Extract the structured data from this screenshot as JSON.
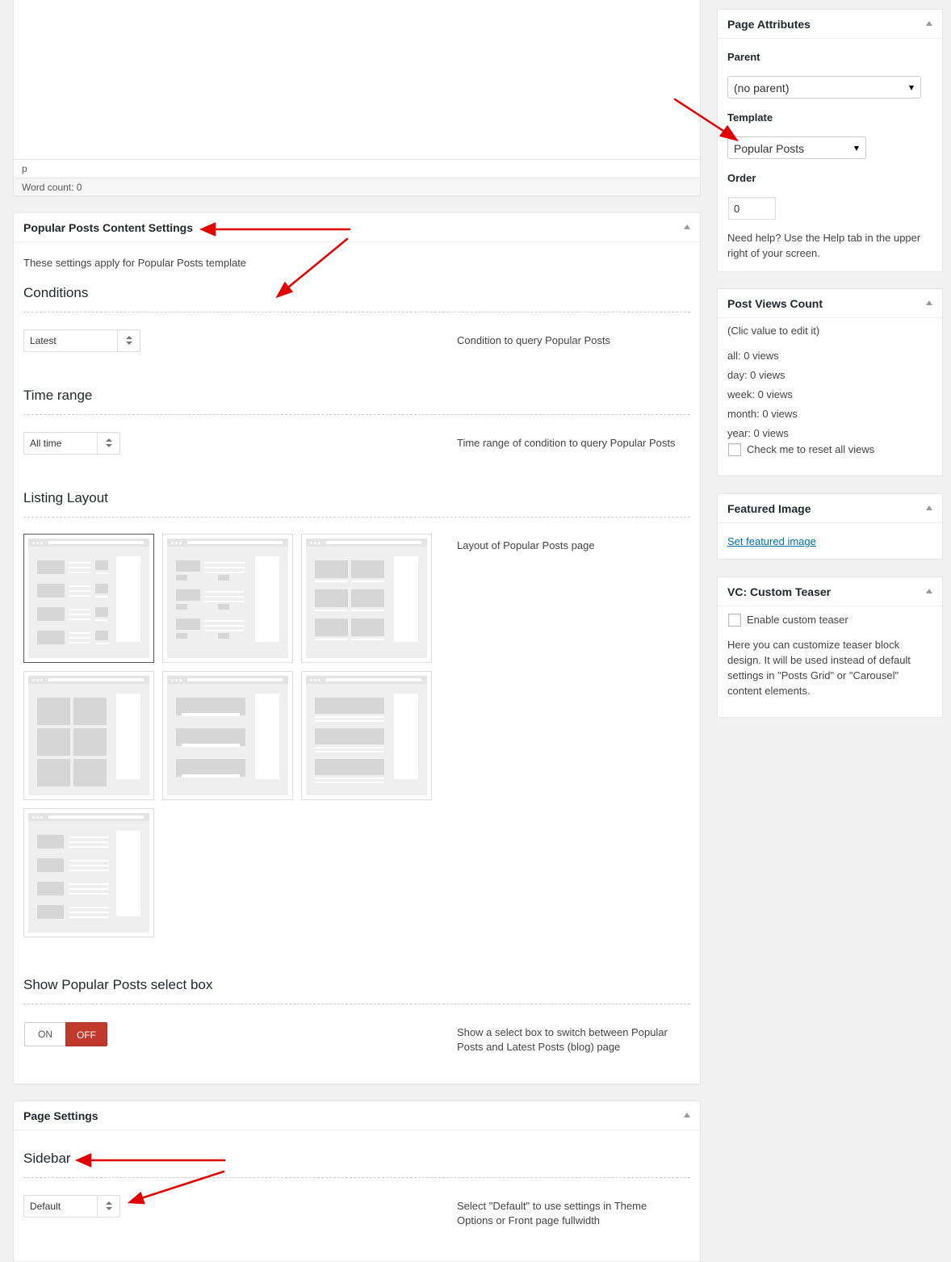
{
  "editor": {
    "path": "p",
    "word_count": "Word count: 0"
  },
  "pp_box": {
    "title": "Popular Posts Content Settings",
    "intro": "These settings apply for Popular Posts template",
    "conditions": {
      "heading": "Conditions",
      "value": "Latest",
      "help": "Condition to query Popular Posts"
    },
    "time_range": {
      "heading": "Time range",
      "value": "All time",
      "help": "Time range of condition to query Popular Posts"
    },
    "listing_layout": {
      "heading": "Listing Layout",
      "help": "Layout of Popular Posts page",
      "options": [
        "layout-1",
        "layout-2",
        "layout-3",
        "layout-4",
        "layout-5",
        "layout-6",
        "layout-7"
      ],
      "selected": "layout-1"
    },
    "select_box": {
      "heading": "Show Popular Posts select box",
      "on_label": "ON",
      "off_label": "OFF",
      "state": "OFF",
      "help_line1": "Show a select box to switch between Popular",
      "help_line2": "Posts and Latest Posts (blog) page"
    }
  },
  "page_settings": {
    "title": "Page Settings",
    "sidebar": {
      "heading": "Sidebar",
      "value": "Default",
      "help_line1": "Select \"Default\" to use settings in Theme",
      "help_line2": "Options or Front page fullwidth"
    }
  },
  "page_attributes": {
    "title": "Page Attributes",
    "parent_label": "Parent",
    "parent_value": "(no parent)",
    "template_label": "Template",
    "template_value": "Popular Posts",
    "order_label": "Order",
    "order_value": "0",
    "help_line1": "Need help? Use the Help tab in the upper",
    "help_line2": "right of your screen."
  },
  "post_views": {
    "title": "Post Views Count",
    "hint": "(Clic value to edit it)",
    "lines": [
      "all: 0 views",
      "day: 0 views",
      "week: 0 views",
      "month: 0 views",
      "year: 0 views"
    ],
    "reset_label": "Check me to reset all views"
  },
  "featured_image": {
    "title": "Featured Image",
    "link": "Set featured image"
  },
  "vc_teaser": {
    "title": "VC: Custom Teaser",
    "enable_label": "Enable custom teaser",
    "desc_lines": [
      "Here you can customize teaser block",
      "design. It will be used instead of default",
      "settings in \"Posts Grid\" or \"Carousel\"",
      "content elements."
    ]
  },
  "colors": {
    "accent_off": "#c0392b",
    "link": "#0073aa",
    "annotation_arrow": "#e00000"
  }
}
